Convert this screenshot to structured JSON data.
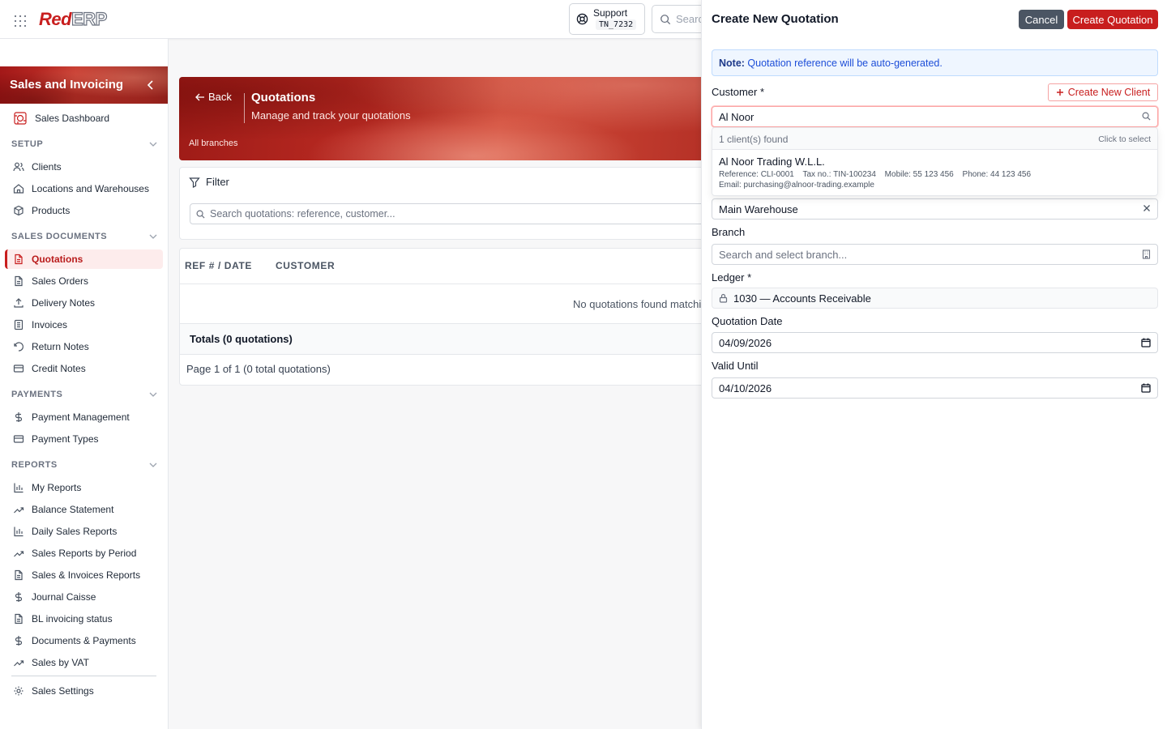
{
  "topbar": {
    "logo_red": "Red",
    "logo_rest": "ERP",
    "support_label": "Support",
    "support_code": "TN_7232",
    "search_placeholder": "Searc"
  },
  "sidebar": {
    "title": "Sales and Invoicing",
    "dashboard": "Sales Dashboard",
    "sections": {
      "setup": "SETUP",
      "sales_documents": "SALES DOCUMENTS",
      "payments": "PAYMENTS",
      "reports": "REPORTS"
    },
    "setup_items": [
      "Clients",
      "Locations and Warehouses",
      "Products"
    ],
    "sales_items": [
      "Quotations",
      "Sales Orders",
      "Delivery Notes",
      "Invoices",
      "Return Notes",
      "Credit Notes"
    ],
    "payment_items": [
      "Payment Management",
      "Payment Types"
    ],
    "report_items": [
      "My Reports",
      "Balance Statement",
      "Daily Sales Reports",
      "Sales Reports by Period",
      "Sales & Invoices Reports",
      "Journal Caisse",
      "BL invoicing status",
      "Documents & Payments",
      "Sales by VAT"
    ],
    "settings": "Sales Settings",
    "active": "Quotations"
  },
  "banner": {
    "back": "Back",
    "title": "Quotations",
    "subtitle": "Manage and track your quotations",
    "branch": "All branches"
  },
  "filter": {
    "label": "Filter",
    "placeholder": "Search quotations: reference, customer..."
  },
  "table": {
    "columns": [
      "REF # / DATE",
      "CUSTOMER"
    ],
    "empty": "No quotations found matchi",
    "totals": "Totals (0 quotations)",
    "pagination": "Page 1 of 1 (0 total quotations)"
  },
  "drawer": {
    "title": "Create New Quotation",
    "cancel": "Cancel",
    "create": "Create Quotation",
    "note_bold": "Note:",
    "note_text": " Quotation reference will be auto-generated.",
    "customer_label": "Customer *",
    "create_client": "Create New Client",
    "customer_value": "Al Noor",
    "dropdown": {
      "count": "1 client(s) found",
      "hint": "Click to select",
      "client_name": "Al Noor Trading W.L.L.",
      "reference": "Reference: CLI-0001",
      "tax": "Tax no.: TIN-100234",
      "mobile": "Mobile: 55 123 456",
      "phone": "Phone: 44 123 456",
      "email": "Email: purchasing@alnoor-trading.example"
    },
    "warehouse_value": "Main Warehouse",
    "branch_label": "Branch",
    "branch_placeholder": "Search and select branch...",
    "ledger_label": "Ledger *",
    "ledger_value": "1030 — Accounts Receivable",
    "quotation_date_label": "Quotation Date",
    "quotation_date": "04/09/2026",
    "valid_until_label": "Valid Until",
    "valid_until": "04/10/2026"
  },
  "colors": {
    "brand": "#c81e1e",
    "cancel": "#4b5563",
    "note_bg": "#eff6ff"
  }
}
